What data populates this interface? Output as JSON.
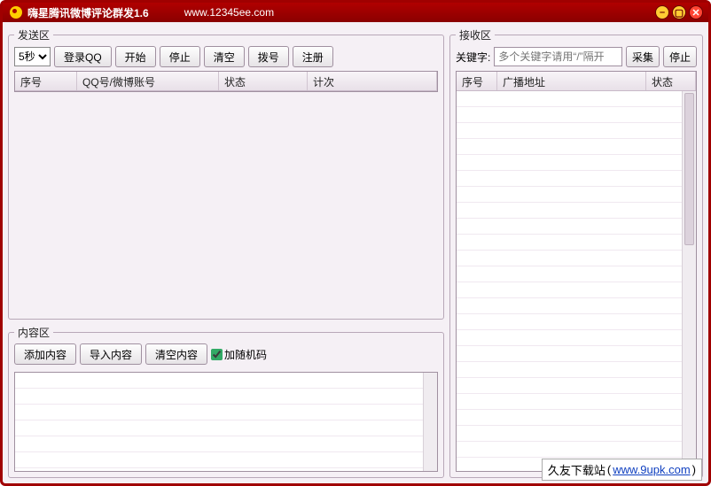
{
  "title_bar": {
    "app_title": "嗨星腾讯微博评论群发1.6",
    "url": "www.12345ee.com"
  },
  "send": {
    "legend": "发送区",
    "interval_selected": "5秒",
    "buttons": {
      "login_qq": "登录QQ",
      "start": "开始",
      "stop": "停止",
      "clear": "清空",
      "dial": "拨号",
      "register": "注册"
    },
    "columns": {
      "seq": "序号",
      "account": "QQ号/微博账号",
      "status": "状态",
      "count": "计次"
    }
  },
  "content": {
    "legend": "内容区",
    "buttons": {
      "add": "添加内容",
      "import": "导入内容",
      "clear": "清空内容"
    },
    "random_checkbox_label": "加随机码",
    "random_checked": true
  },
  "receive": {
    "legend": "接收区",
    "keyword_label": "关键字:",
    "keyword_placeholder": "多个关键字请用“/”隔开",
    "keyword_value": "",
    "buttons": {
      "collect": "采集",
      "stop": "停止"
    },
    "columns": {
      "seq": "序号",
      "broadcast": "广播地址",
      "status": "状态"
    }
  },
  "watermark": {
    "site_name": "久友下载站",
    "url_text": "www.9upk.com"
  }
}
